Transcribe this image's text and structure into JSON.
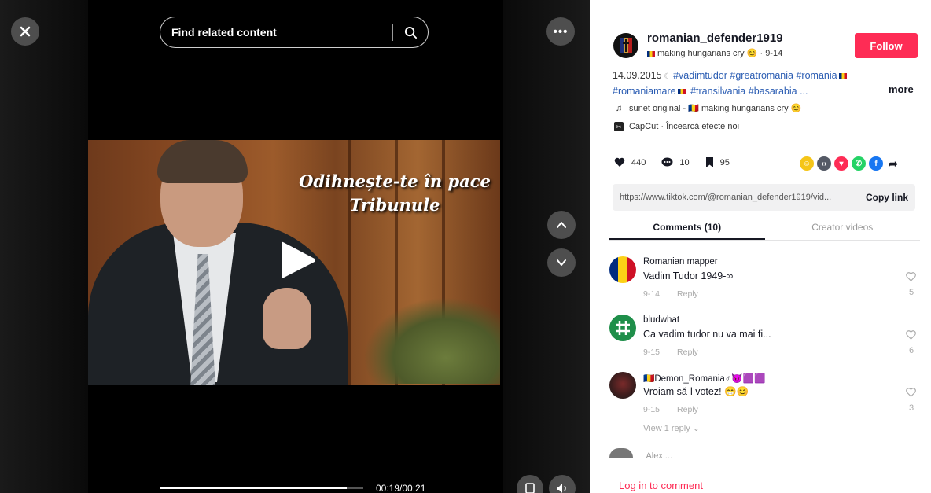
{
  "colors": {
    "accent": "#fe2c55",
    "hashtag": "#2b5db3",
    "video_bg": "#000000"
  },
  "video": {
    "search_placeholder": "Find related content",
    "overlay_line1": "Odihnește-te în pace",
    "overlay_line2": "Tribunule",
    "time": "00:19/00:21",
    "progress": 0.92,
    "icons": [
      "close-icon",
      "search-icon",
      "more-icon",
      "chevron-up-icon",
      "chevron-down-icon",
      "play-icon",
      "picture-in-picture-icon",
      "volume-icon"
    ]
  },
  "author": {
    "username": "romanian_defender1919",
    "subtitle": "making hungarians cry 😊 · 9-14",
    "follow_label": "Follow"
  },
  "caption": {
    "date": "14.09.2015",
    "tags": [
      "#vadimtudor",
      "#greatromania",
      "#romania",
      "#romaniamare",
      "#transilvania",
      "#basarabia ..."
    ],
    "more_label": "more"
  },
  "music": {
    "text": "sunet original - 🇷🇴 making hungarians cry 😊"
  },
  "capcut": {
    "text": "CapCut · Încearcă efecte noi"
  },
  "stats": {
    "likes": "440",
    "comments": "10",
    "saves": "95"
  },
  "share": {
    "icons": [
      "smile-share-icon",
      "embed-icon",
      "send-icon",
      "whatsapp-icon",
      "facebook-icon",
      "share-arrow-icon"
    ]
  },
  "link": {
    "url": "https://www.tiktok.com/@romanian_defender1919/vid...",
    "copy_label": "Copy link"
  },
  "tabs": [
    {
      "label": "Comments (10)",
      "active": true
    },
    {
      "label": "Creator videos",
      "active": false
    }
  ],
  "comments": [
    {
      "name": "Romanian mapper",
      "text": "Vadim Tudor 1949-∞",
      "date": "9-14",
      "reply": "Reply",
      "likes": "5"
    },
    {
      "name": "bludwhat",
      "text": "Ca vadim tudor nu va mai fi...",
      "date": "9-15",
      "reply": "Reply",
      "likes": "6"
    },
    {
      "name": "🇷🇴Demon_Romania♂😈🟪🟪",
      "text": "Vroiam să-l votez! 😁😊",
      "date": "9-15",
      "reply": "Reply",
      "likes": "3"
    }
  ],
  "view_reply": "View 1 reply ⌄",
  "partial_comment_name": "Alex ...",
  "login_label": "Log in to comment"
}
